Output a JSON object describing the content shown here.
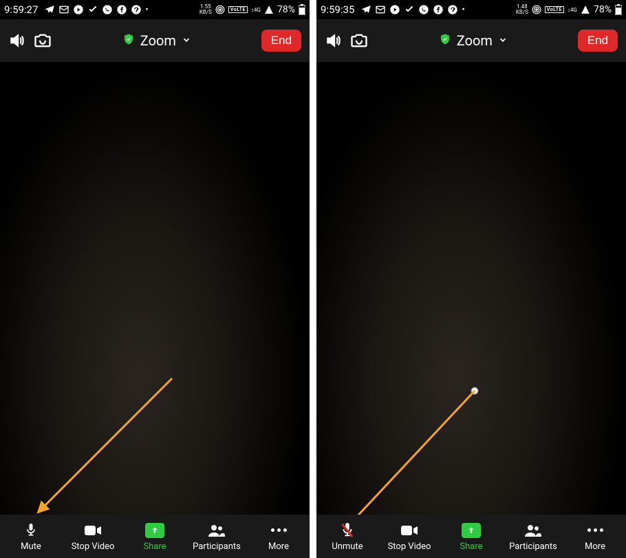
{
  "screens": [
    {
      "status": {
        "time": "9:59:27",
        "kbps_top": "1.55",
        "kbps_bot": "KB/S",
        "volte": "VoLTE",
        "net": "4G",
        "battery": "78%"
      },
      "header": {
        "title": "Zoom",
        "end": "End"
      },
      "bottom": {
        "mute": "Mute",
        "stopvideo": "Stop Video",
        "share": "Share",
        "participants": "Participants",
        "more": "More"
      }
    },
    {
      "status": {
        "time": "9:59:35",
        "kbps_top": "1.48",
        "kbps_bot": "KB/S",
        "volte": "VoLTE",
        "net": "4G",
        "battery": "78%"
      },
      "header": {
        "title": "Zoom",
        "end": "End"
      },
      "bottom": {
        "mute": "Unmute",
        "stopvideo": "Stop Video",
        "share": "Share",
        "participants": "Participants",
        "more": "More"
      }
    }
  ]
}
